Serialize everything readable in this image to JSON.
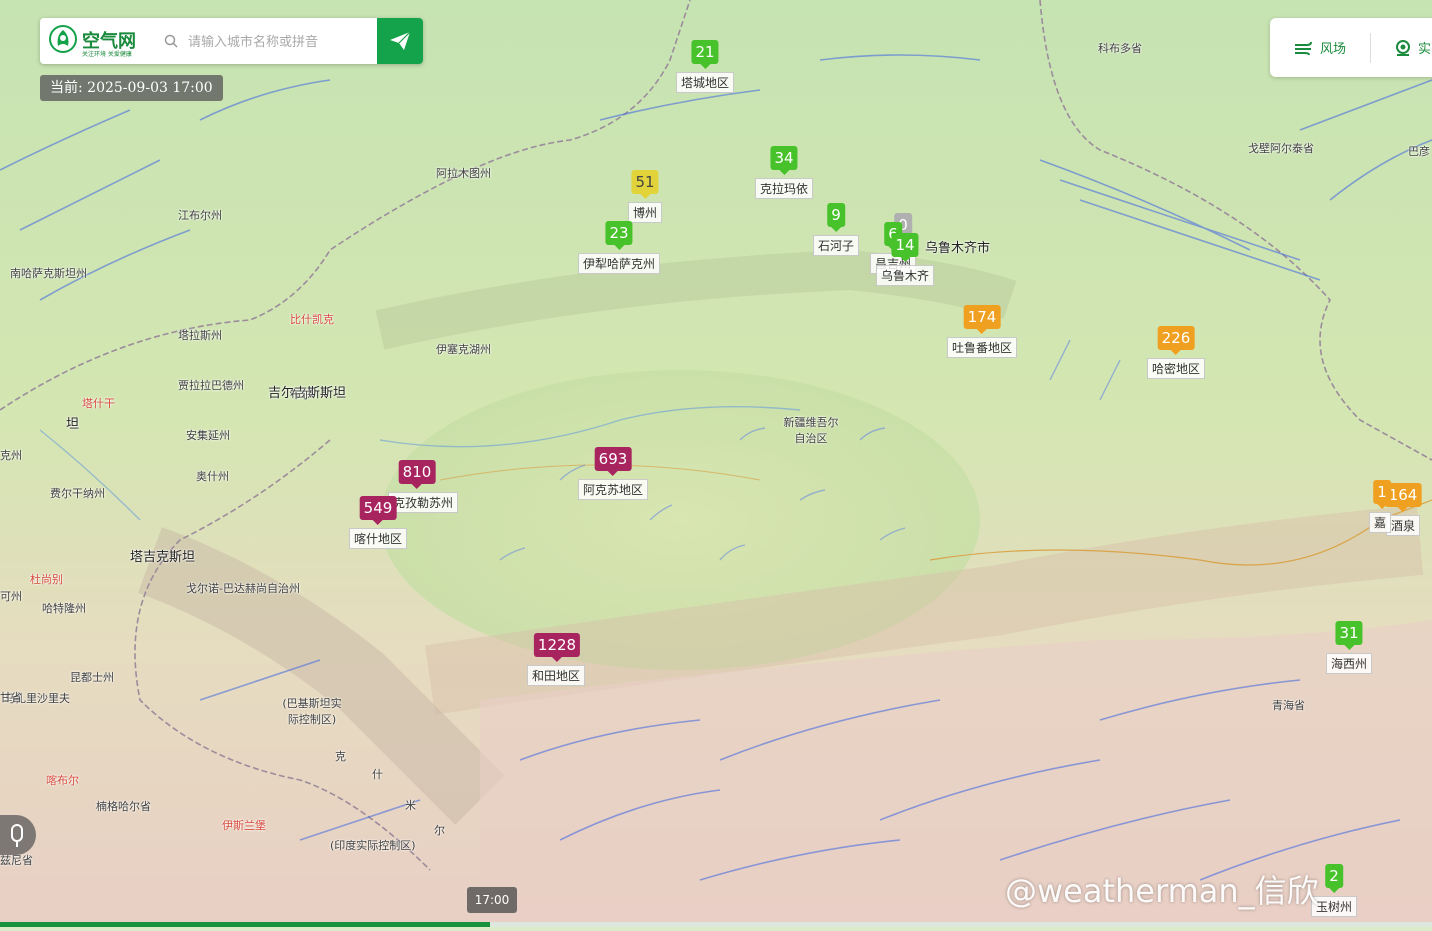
{
  "header": {
    "logo_name": "空气网",
    "logo_sub": "关注环境  关爱健康",
    "search_placeholder": "请输入城市名称或拼音",
    "current_time": "当前: 2025-09-03 17:00"
  },
  "tools": {
    "wind_label": "风场",
    "live_label": "实"
  },
  "markers": [
    {
      "value": "21",
      "label": "塔城地区",
      "level": "good"
    },
    {
      "value": "34",
      "label": "克拉玛依",
      "level": "good"
    },
    {
      "value": "51",
      "label": "博州",
      "level": "moderate"
    },
    {
      "value": "23",
      "label": "伊犁哈萨克州",
      "level": "good"
    },
    {
      "value": "9",
      "label": "石河子",
      "level": "good"
    },
    {
      "value": "0",
      "label": "",
      "level": "nodata"
    },
    {
      "value": "6",
      "label": "昌吉州",
      "level": "good"
    },
    {
      "value": "14",
      "label": "乌鲁木齐",
      "level": "good"
    },
    {
      "value": "174",
      "label": "吐鲁番地区",
      "level": "unhealthy"
    },
    {
      "value": "226",
      "label": "哈密地区",
      "level": "unhealthy"
    },
    {
      "value": "810",
      "label": "克孜勒苏州",
      "level": "hazardous"
    },
    {
      "value": "549",
      "label": "喀什地区",
      "level": "hazardous"
    },
    {
      "value": "693",
      "label": "阿克苏地区",
      "level": "hazardous"
    },
    {
      "value": "1228",
      "label": "和田地区",
      "level": "hazardous"
    },
    {
      "value": "164",
      "label": "酒泉",
      "level": "unhealthy"
    },
    {
      "value": "1",
      "label": "嘉",
      "level": "unhealthy"
    },
    {
      "value": "31",
      "label": "海西州",
      "level": "good"
    },
    {
      "value": "2",
      "label": "玉树州",
      "level": "good"
    }
  ],
  "colors": {
    "good": "#48c22b",
    "moderate": "#e2d33a",
    "unhealthy": "#f0a020",
    "hazardous": "#a8245f",
    "nodata": "#b0b0b0",
    "brand": "#14a24a"
  },
  "place_names": [
    "科布多省",
    "戈壁阿尔泰省",
    "巴彦",
    "阿拉木图州",
    "江布尔州",
    "南哈萨克斯坦州",
    "比什凯克",
    "塔拉斯州",
    "伊塞克湖州",
    "贾拉拉巴德州",
    "吉尔吉斯斯坦",
    "塔什干",
    "坦",
    "安集延州",
    "奥什州",
    "费尔干纳州",
    "杜尚别",
    "哈特隆州",
    "戈尔诺-巴达赫尚自治州",
    "塔吉克斯坦",
    "马扎里沙里夫",
    "昆都士州",
    "楠格哈尔省",
    "喀布尔",
    "伊斯兰堡",
    "(巴基斯坦实际控制区)",
    "(印度实际控制区)",
    "克",
    "什",
    "米",
    "尔",
    "兹尼省",
    "新疆维吾尔自治区",
    "乌鲁木齐市",
    "青海省",
    "克州",
    "可州",
    "甘省",
    "布尔"
  ],
  "timeline": {
    "thumb_label": "17:00"
  },
  "watermark": "@weatherman_信欣"
}
